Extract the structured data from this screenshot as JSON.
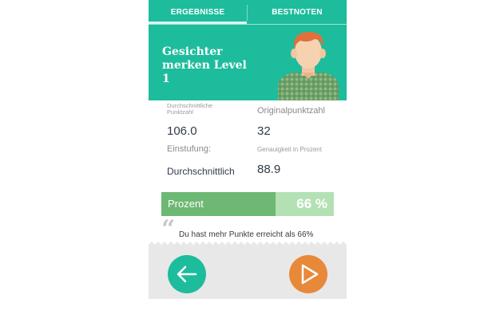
{
  "tabs": {
    "results": "ERGEBNISSE",
    "highscores": "BESTNOTEN"
  },
  "header": {
    "title": "Gesichter merken Level 1"
  },
  "stats": {
    "average_label": "Durchschnittliche Punktzahl",
    "average_value": "106.0",
    "original_label": "Originalpunktzahl",
    "original_value": "32",
    "rating_label": "Einstufung:",
    "rating_value": "Durchschnittlich",
    "accuracy_label": "Genauigkeit in Prozent",
    "accuracy_value": "88.9"
  },
  "percent": {
    "label": "Prozent",
    "value_text": "66 %",
    "fraction": 0.66
  },
  "quote": {
    "text": "Du hast mehr Punkte erreicht als 66%"
  },
  "icons": {
    "back": "arrow-left-icon",
    "play": "play-icon"
  },
  "colors": {
    "teal": "#1dbc9c",
    "green": "#6db873",
    "light_green": "#b3e1b4",
    "orange": "#e8893a"
  }
}
